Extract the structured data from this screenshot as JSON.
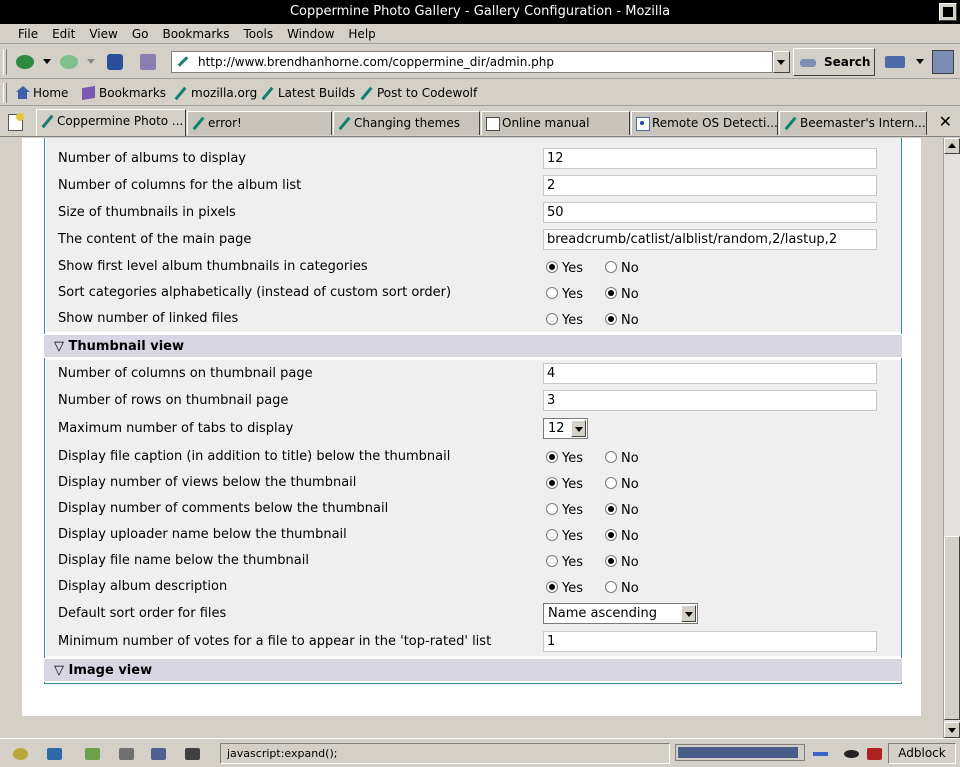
{
  "window": {
    "title": "Coppermine Photo Gallery - Gallery Configuration - Mozilla"
  },
  "menu": [
    "File",
    "Edit",
    "View",
    "Go",
    "Bookmarks",
    "Tools",
    "Window",
    "Help"
  ],
  "navbar": {
    "url": "http://www.brendhanhorne.com/coppermine_dir/admin.php",
    "search_label": "Search"
  },
  "personal_toolbar": [
    "Home",
    "Bookmarks",
    "mozilla.org",
    "Latest Builds",
    "Post to Codewolf"
  ],
  "tabs": [
    {
      "label": "Coppermine Photo ...",
      "icon": "pen-icon",
      "active": true
    },
    {
      "label": "error!",
      "icon": "pen-icon",
      "active": false
    },
    {
      "label": "Changing themes",
      "icon": "pen-icon",
      "active": false
    },
    {
      "label": "Online manual",
      "icon": "manual-icon",
      "active": false
    },
    {
      "label": "Remote OS Detecti...",
      "icon": "os-icon",
      "active": false
    },
    {
      "label": "Beemaster's Intern...",
      "icon": "pen-icon",
      "active": false
    }
  ],
  "radio": {
    "yes": "Yes",
    "no": "No"
  },
  "album_settings": [
    {
      "label": "Number of albums to display",
      "type": "text",
      "value": "12"
    },
    {
      "label": "Number of columns for the album list",
      "type": "text",
      "value": "2"
    },
    {
      "label": "Size of thumbnails in pixels",
      "type": "text",
      "value": "50"
    },
    {
      "label": "The content of the main page",
      "type": "text",
      "value": "breadcrumb/catlist/alblist/random,2/lastup,2"
    },
    {
      "label": "Show first level album thumbnails in categories",
      "type": "radio",
      "value": "yes"
    },
    {
      "label": "Sort categories alphabetically (instead of custom sort order)",
      "type": "radio",
      "value": "no"
    },
    {
      "label": "Show number of linked files",
      "type": "radio",
      "value": "no"
    }
  ],
  "thumbnail_section": {
    "title": "▽ Thumbnail view",
    "settings": [
      {
        "label": "Number of columns on thumbnail page",
        "type": "text",
        "value": "4"
      },
      {
        "label": "Number of rows on thumbnail page",
        "type": "text",
        "value": "3"
      },
      {
        "label": "Maximum number of tabs to display",
        "type": "select",
        "value": "12"
      },
      {
        "label": "Display file caption (in addition to title) below the thumbnail",
        "type": "radio",
        "value": "yes"
      },
      {
        "label": "Display number of views below the thumbnail",
        "type": "radio",
        "value": "yes"
      },
      {
        "label": "Display number of comments below the thumbnail",
        "type": "radio",
        "value": "no"
      },
      {
        "label": "Display uploader name below the thumbnail",
        "type": "radio",
        "value": "no"
      },
      {
        "label": "Display file name below the thumbnail",
        "type": "radio",
        "value": "no"
      },
      {
        "label": "Display album description",
        "type": "radio",
        "value": "yes"
      },
      {
        "label": "Default sort order for files",
        "type": "select",
        "value": "Name ascending"
      },
      {
        "label": "Minimum number of votes for a file to appear in the 'top-rated' list",
        "type": "text",
        "value": "1"
      }
    ]
  },
  "image_section": {
    "title": "▽ Image view"
  },
  "status": {
    "text": "javascript:expand();",
    "adblock": "Adblock",
    "progress_fraction": 0.97
  }
}
